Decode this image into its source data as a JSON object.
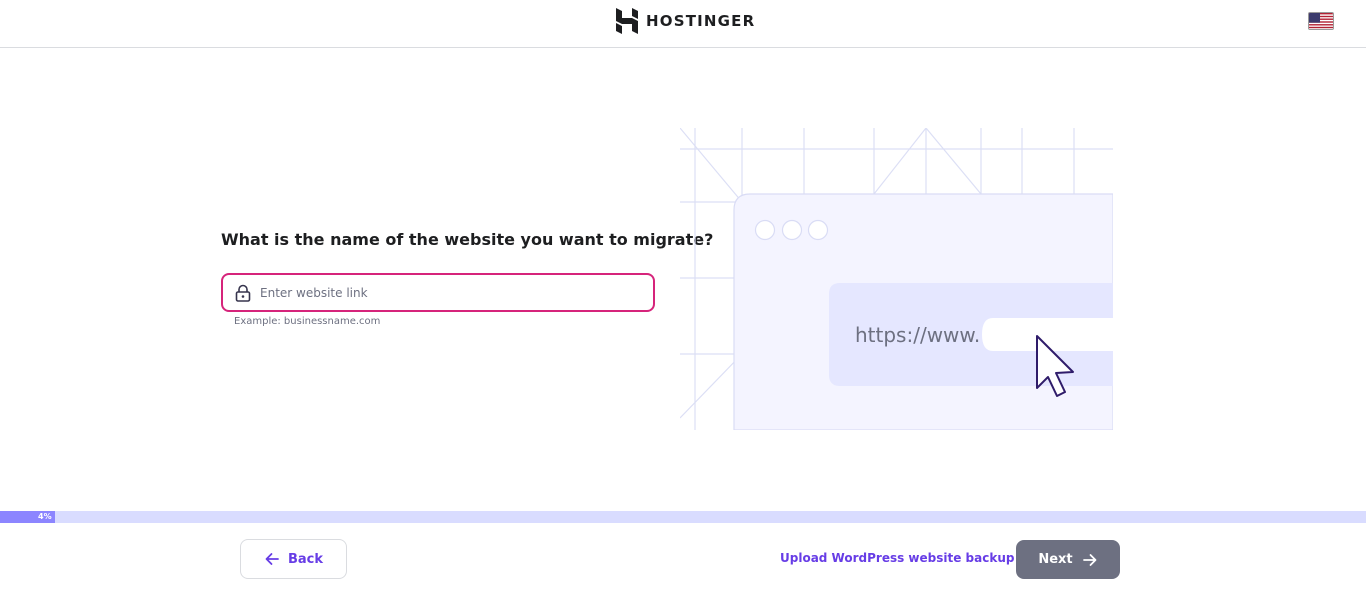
{
  "header": {
    "brand": "HOSTINGER",
    "language_icon": "us-flag-icon"
  },
  "main": {
    "question": "What is the name of the website you want to migrate?",
    "input": {
      "value": "",
      "placeholder": "Enter website link",
      "icon": "lock-icon"
    },
    "hint": "Example: businessname.com",
    "illustration": {
      "url_prefix": "https://www."
    }
  },
  "progress": {
    "percent": 4,
    "label": "4%"
  },
  "footer": {
    "back_label": "Back",
    "upload_label": "Upload WordPress website backup",
    "next_label": "Next"
  },
  "colors": {
    "accent": "#673de6",
    "input_border": "#d6247b",
    "next_button": "#6d7081",
    "progress_fill": "#8c85ff",
    "progress_track": "#d9dcff"
  }
}
